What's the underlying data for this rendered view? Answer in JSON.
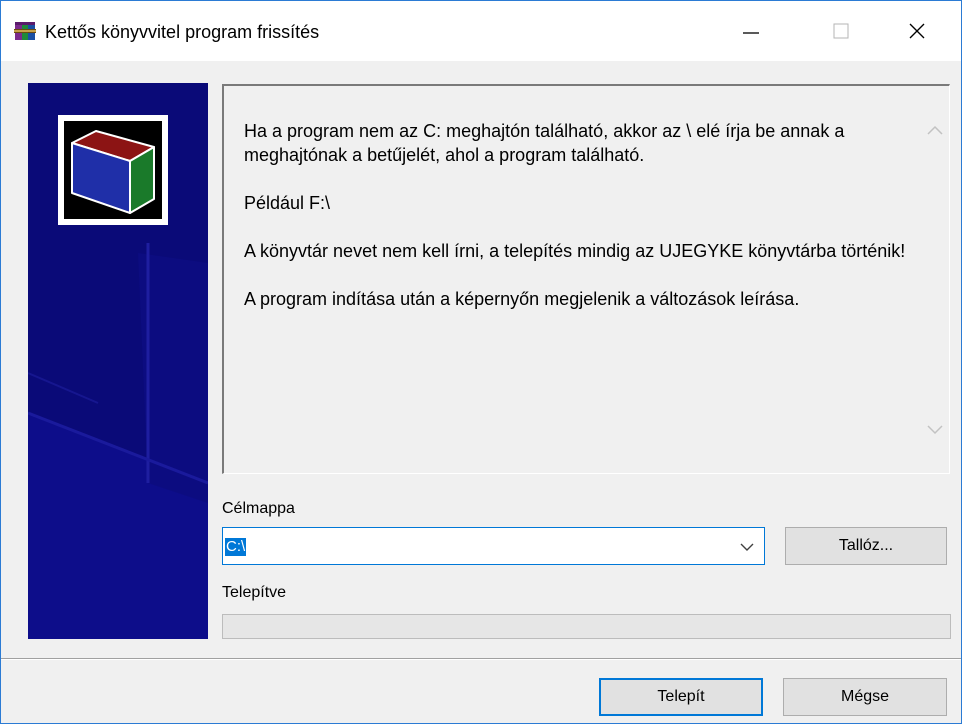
{
  "window": {
    "title": "Kettős könyvvitel program frissítés",
    "app_icon": "winrar-archive-icon",
    "controls": {
      "minimize_icon": "minimize-icon",
      "maximize_icon": "maximize-icon",
      "close_icon": "close-icon"
    }
  },
  "banner": {
    "logo_icon": "book-box-icon",
    "background_color": "#0a0a78"
  },
  "info": {
    "paragraphs": [
      "Ha a program nem az C: meghajtón található, akkor az \\ elé írja be annak a meghajtónak a betűjelét, ahol a program található.",
      "Például  F:\\",
      "A könyvtár nevet nem kell írni, a telepítés mindig az UJEGYKE könyvtárba történik!",
      "A program indítása után a képernyőn megjelenik a változások leírása."
    ]
  },
  "destination": {
    "label": "Célmappa",
    "value": "C:\\",
    "browse_label": "Tallóz..."
  },
  "progress": {
    "label": "Telepítve",
    "value_percent": 0
  },
  "buttons": {
    "install_label": "Telepít",
    "cancel_label": "Mégse"
  },
  "colors": {
    "accent": "#0078d7",
    "face": "#f0f0f0"
  }
}
